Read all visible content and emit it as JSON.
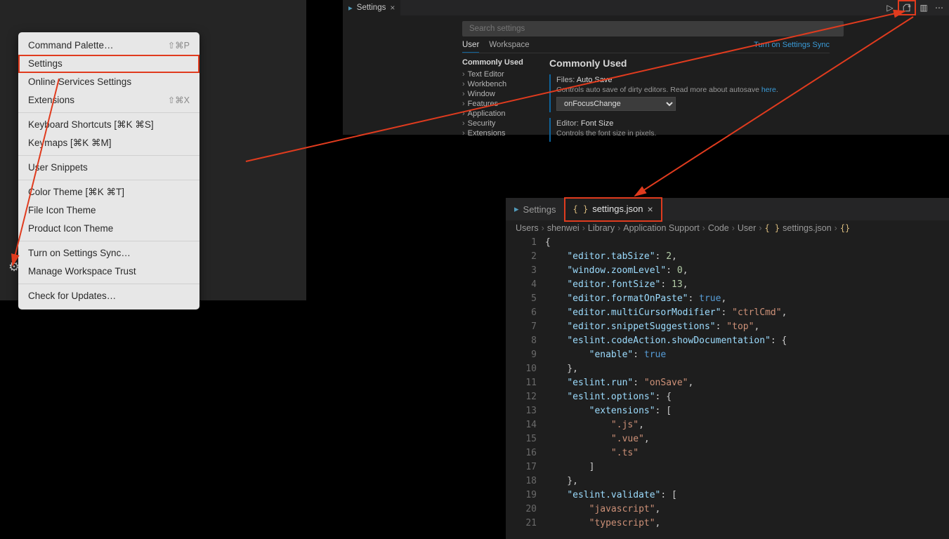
{
  "contextMenu": {
    "items": [
      {
        "label": "Command Palette…",
        "shortcut": "⇧⌘P"
      },
      {
        "label": "Settings",
        "shortcut": "",
        "selected": true
      },
      {
        "label": "Online Services Settings",
        "shortcut": ""
      },
      {
        "label": "Extensions",
        "shortcut": "⇧⌘X"
      },
      {
        "sep": true
      },
      {
        "label": "Keyboard Shortcuts [⌘K ⌘S]",
        "shortcut": ""
      },
      {
        "label": "Keymaps [⌘K ⌘M]",
        "shortcut": ""
      },
      {
        "sep": true
      },
      {
        "label": "User Snippets",
        "shortcut": ""
      },
      {
        "sep": true
      },
      {
        "label": "Color Theme [⌘K ⌘T]",
        "shortcut": ""
      },
      {
        "label": "File Icon Theme",
        "shortcut": ""
      },
      {
        "label": "Product Icon Theme",
        "shortcut": ""
      },
      {
        "sep": true
      },
      {
        "label": "Turn on Settings Sync…",
        "shortcut": ""
      },
      {
        "label": "Manage Workspace Trust",
        "shortcut": ""
      },
      {
        "sep": true
      },
      {
        "label": "Check for Updates…",
        "shortcut": ""
      }
    ]
  },
  "settingsWindow": {
    "tabLabel": "Settings",
    "searchPlaceholder": "Search settings",
    "scopes": [
      "User",
      "Workspace"
    ],
    "syncLink": "Turn on Settings Sync",
    "treeHeader": "Commonly Used",
    "treeItems": [
      "Text Editor",
      "Workbench",
      "Window",
      "Features",
      "Application",
      "Security",
      "Extensions"
    ],
    "mainHeader": "Commonly Used",
    "autoSave": {
      "titleA": "Files:",
      "titleB": "Auto Save",
      "desc1": "Controls auto save of dirty editors. Read more about autosave ",
      "descLink": "here",
      "desc2": ".",
      "value": "onFocusChange"
    },
    "fontSize": {
      "titleA": "Editor:",
      "titleB": "Font Size",
      "desc": "Controls the font size in pixels."
    }
  },
  "editorWindow": {
    "settingsTab": "Settings",
    "jsonTab": "settings.json",
    "breadcrumbs": [
      "Users",
      "shenwei",
      "Library",
      "Application Support",
      "Code",
      "User",
      "settings.json",
      "{}"
    ],
    "code": {
      "lines": [
        {
          "n": 1,
          "tokens": [
            [
              "punct",
              "{"
            ]
          ]
        },
        {
          "n": 2,
          "tokens": [
            [
              "punct",
              "    "
            ],
            [
              "key",
              "\"editor.tabSize\""
            ],
            [
              "punct",
              ": "
            ],
            [
              "num",
              "2"
            ],
            [
              "punct",
              ","
            ]
          ]
        },
        {
          "n": 3,
          "tokens": [
            [
              "punct",
              "    "
            ],
            [
              "key",
              "\"window.zoomLevel\""
            ],
            [
              "punct",
              ": "
            ],
            [
              "num",
              "0"
            ],
            [
              "punct",
              ","
            ]
          ]
        },
        {
          "n": 4,
          "tokens": [
            [
              "punct",
              "    "
            ],
            [
              "key",
              "\"editor.fontSize\""
            ],
            [
              "punct",
              ": "
            ],
            [
              "num",
              "13"
            ],
            [
              "punct",
              ","
            ]
          ]
        },
        {
          "n": 5,
          "tokens": [
            [
              "punct",
              "    "
            ],
            [
              "key",
              "\"editor.formatOnPaste\""
            ],
            [
              "punct",
              ": "
            ],
            [
              "bool",
              "true"
            ],
            [
              "punct",
              ","
            ]
          ]
        },
        {
          "n": 6,
          "tokens": [
            [
              "punct",
              "    "
            ],
            [
              "key",
              "\"editor.multiCursorModifier\""
            ],
            [
              "punct",
              ": "
            ],
            [
              "str",
              "\"ctrlCmd\""
            ],
            [
              "punct",
              ","
            ]
          ]
        },
        {
          "n": 7,
          "tokens": [
            [
              "punct",
              "    "
            ],
            [
              "key",
              "\"editor.snippetSuggestions\""
            ],
            [
              "punct",
              ": "
            ],
            [
              "str",
              "\"top\""
            ],
            [
              "punct",
              ","
            ]
          ]
        },
        {
          "n": 8,
          "tokens": [
            [
              "punct",
              "    "
            ],
            [
              "key",
              "\"eslint.codeAction.showDocumentation\""
            ],
            [
              "punct",
              ": {"
            ]
          ]
        },
        {
          "n": 9,
          "tokens": [
            [
              "punct",
              "        "
            ],
            [
              "key",
              "\"enable\""
            ],
            [
              "punct",
              ": "
            ],
            [
              "bool",
              "true"
            ]
          ]
        },
        {
          "n": 10,
          "tokens": [
            [
              "punct",
              "    },"
            ]
          ]
        },
        {
          "n": 11,
          "tokens": [
            [
              "punct",
              "    "
            ],
            [
              "key",
              "\"eslint.run\""
            ],
            [
              "punct",
              ": "
            ],
            [
              "str",
              "\"onSave\""
            ],
            [
              "punct",
              ","
            ]
          ]
        },
        {
          "n": 12,
          "tokens": [
            [
              "punct",
              "    "
            ],
            [
              "key",
              "\"eslint.options\""
            ],
            [
              "punct",
              ": {"
            ]
          ]
        },
        {
          "n": 13,
          "tokens": [
            [
              "punct",
              "        "
            ],
            [
              "key",
              "\"extensions\""
            ],
            [
              "punct",
              ": ["
            ]
          ]
        },
        {
          "n": 14,
          "tokens": [
            [
              "punct",
              "            "
            ],
            [
              "str",
              "\".js\""
            ],
            [
              "punct",
              ","
            ]
          ]
        },
        {
          "n": 15,
          "tokens": [
            [
              "punct",
              "            "
            ],
            [
              "str",
              "\".vue\""
            ],
            [
              "punct",
              ","
            ]
          ]
        },
        {
          "n": 16,
          "tokens": [
            [
              "punct",
              "            "
            ],
            [
              "str",
              "\".ts\""
            ]
          ]
        },
        {
          "n": 17,
          "tokens": [
            [
              "punct",
              "        ]"
            ]
          ]
        },
        {
          "n": 18,
          "tokens": [
            [
              "punct",
              "    },"
            ]
          ]
        },
        {
          "n": 19,
          "tokens": [
            [
              "punct",
              "    "
            ],
            [
              "key",
              "\"eslint.validate\""
            ],
            [
              "punct",
              ": ["
            ]
          ]
        },
        {
          "n": 20,
          "tokens": [
            [
              "punct",
              "        "
            ],
            [
              "str",
              "\"javascript\""
            ],
            [
              "punct",
              ","
            ]
          ]
        },
        {
          "n": 21,
          "tokens": [
            [
              "punct",
              "        "
            ],
            [
              "str",
              "\"typescript\""
            ],
            [
              "punct",
              ","
            ]
          ]
        }
      ]
    }
  }
}
